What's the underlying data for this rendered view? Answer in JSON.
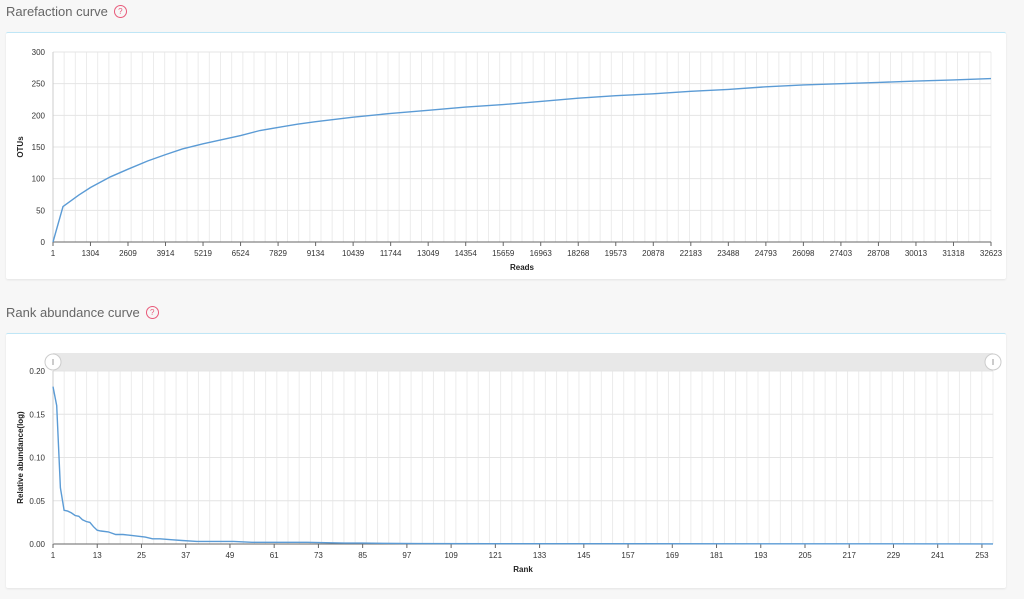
{
  "sections": {
    "rarefaction": {
      "title": "Rarefaction curve"
    },
    "rank": {
      "title": "Rank abundance curve"
    }
  },
  "colors": {
    "line": "#5b9bd5",
    "help": "#e85a7a",
    "panel_border": "#bfe6f6"
  },
  "icons": {
    "help": "question-circle-icon"
  },
  "chart_data": [
    {
      "type": "line",
      "xlabel": "Reads",
      "ylabel": "OTUs",
      "xlim": [
        1,
        32623
      ],
      "ylim": [
        0,
        300
      ],
      "yticks": [
        0,
        50,
        100,
        150,
        200,
        250,
        300
      ],
      "xticks": [
        1,
        1304,
        2609,
        3914,
        5219,
        6524,
        7829,
        9134,
        10439,
        11744,
        13049,
        14354,
        15659,
        16963,
        18268,
        19573,
        20878,
        22183,
        23488,
        24793,
        26098,
        27403,
        28708,
        30013,
        31318,
        32623
      ],
      "grid": true,
      "series": [
        {
          "x": [
            1,
            350,
            900,
            1304,
            2000,
            2609,
            3300,
            3914,
            4500,
            5219,
            6524,
            7200,
            7829,
            8500,
            9134,
            10439,
            11744,
            13049,
            14354,
            15659,
            16963,
            18268,
            19573,
            20878,
            22183,
            23488,
            24793,
            26098,
            27403,
            28708,
            30013,
            31318,
            32623
          ],
          "y": [
            0,
            56,
            74,
            86,
            103,
            115,
            128,
            138,
            147,
            155,
            168,
            176,
            181,
            186,
            190,
            197,
            203,
            208,
            213,
            217,
            222,
            227,
            231,
            234,
            238,
            241,
            245,
            248,
            250,
            252,
            254,
            256,
            258
          ]
        }
      ]
    },
    {
      "type": "line",
      "xlabel": "Rank",
      "ylabel": "Relative abundance(log)",
      "xlim": [
        1,
        256
      ],
      "ylim": [
        0,
        0.2
      ],
      "yticks": [
        "0.00",
        "0.05",
        "0.10",
        "0.15",
        "0.20"
      ],
      "xticks": [
        1,
        13,
        25,
        37,
        49,
        61,
        73,
        85,
        97,
        109,
        121,
        133,
        145,
        157,
        169,
        181,
        193,
        205,
        217,
        229,
        241,
        253
      ],
      "grid": true,
      "slider": true,
      "series": [
        {
          "x": [
            1,
            2,
            3,
            4,
            5,
            6,
            7,
            8,
            9,
            10,
            11,
            12,
            13,
            14,
            16,
            18,
            20,
            22,
            24,
            26,
            28,
            30,
            33,
            36,
            40,
            45,
            50,
            55,
            60,
            70,
            80,
            85,
            100,
            120,
            150,
            200,
            256
          ],
          "y": [
            0.182,
            0.16,
            0.065,
            0.039,
            0.038,
            0.036,
            0.033,
            0.032,
            0.028,
            0.026,
            0.025,
            0.02,
            0.016,
            0.015,
            0.014,
            0.011,
            0.011,
            0.01,
            0.009,
            0.008,
            0.006,
            0.006,
            0.005,
            0.004,
            0.003,
            0.003,
            0.003,
            0.002,
            0.002,
            0.002,
            0.001,
            0.001,
            0.0005,
            0.0004,
            0.0003,
            0.0002,
            0.0001
          ]
        }
      ]
    }
  ]
}
